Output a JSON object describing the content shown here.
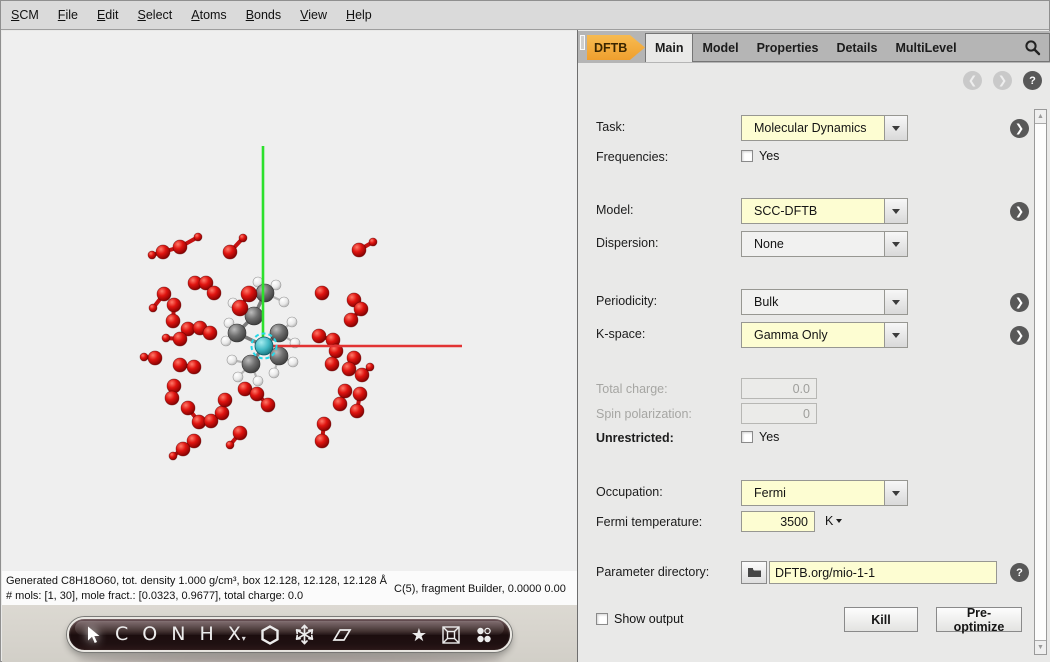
{
  "menubar": {
    "items": [
      {
        "label": "SCM"
      },
      {
        "label": "File"
      },
      {
        "label": "Edit"
      },
      {
        "label": "Select"
      },
      {
        "label": "Atoms"
      },
      {
        "label": "Bonds"
      },
      {
        "label": "View"
      },
      {
        "label": "Help"
      }
    ]
  },
  "panel": {
    "dftb_tab": "DFTB",
    "tabs": [
      {
        "label": "Main",
        "active": true
      },
      {
        "label": "Model"
      },
      {
        "label": "Properties"
      },
      {
        "label": "Details"
      },
      {
        "label": "MultiLevel"
      }
    ],
    "fields": {
      "task": {
        "label": "Task:",
        "value": "Molecular Dynamics"
      },
      "frequencies": {
        "label": "Frequencies:",
        "option": "Yes",
        "checked": false
      },
      "model": {
        "label": "Model:",
        "value": "SCC-DFTB"
      },
      "dispersion": {
        "label": "Dispersion:",
        "value": "None"
      },
      "periodicity": {
        "label": "Periodicity:",
        "value": "Bulk"
      },
      "kspace": {
        "label": "K-space:",
        "value": "Gamma Only"
      },
      "total_charge": {
        "label": "Total charge:",
        "value": "0.0",
        "disabled": true
      },
      "spin_polarization": {
        "label": "Spin polarization:",
        "value": "0",
        "disabled": true
      },
      "unrestricted": {
        "label": "Unrestricted:",
        "option": "Yes",
        "checked": false
      },
      "occupation": {
        "label": "Occupation:",
        "value": "Fermi"
      },
      "fermi_temperature": {
        "label": "Fermi temperature:",
        "value": "3500",
        "unit": "K"
      },
      "parameter_directory": {
        "label": "Parameter directory:",
        "value": "DFTB.org/mio-1-1"
      }
    },
    "show_output": {
      "label": "Show output",
      "checked": false
    },
    "buttons": {
      "kill": "Kill",
      "preoptimize": "Pre-optimize"
    }
  },
  "statusbar": {
    "line1": "Generated C8H18O60, tot. density 1.000 g/cm³, box 12.128, 12.128, 12.128 Å",
    "line2": "# mols: [1, 30], mole fract.: [0.0323, 0.9677], total charge: 0.0",
    "right": "C(5), fragment Builder, 0.0000 0.00"
  },
  "toolbar": {
    "tools": [
      {
        "name": "pointer-tool",
        "active": true
      },
      {
        "name": "carbon-tool",
        "label": "C"
      },
      {
        "name": "oxygen-tool",
        "label": "O"
      },
      {
        "name": "nitrogen-tool",
        "label": "N"
      },
      {
        "name": "hydrogen-tool",
        "label": "H"
      },
      {
        "name": "element-picker-tool",
        "label": "X",
        "dropdown": "▾"
      },
      {
        "name": "ring-tool"
      },
      {
        "name": "crystal-tool"
      },
      {
        "name": "plane-tool"
      },
      {
        "name": "spacer"
      },
      {
        "name": "favorites-tool",
        "label": "★"
      },
      {
        "name": "unit-cell-tool"
      },
      {
        "name": "fragments-tool"
      }
    ]
  },
  "colors": {
    "accent_orange": "#f2a73d",
    "field_yellow": "#fdfdd2",
    "panel_bg": "#e9e9e8",
    "tabbar_bg": "#b5b5b5",
    "axis_green": "#2ce02c",
    "axis_red": "#e23333",
    "atom_red": "#d81414",
    "atom_gray": "#6f6f6f",
    "selection_cyan": "#28d8e8"
  },
  "viewer": {
    "scene": {
      "axes": {
        "green": [
          261,
          115,
          261,
          315
        ],
        "red": [
          262,
          315,
          460,
          315
        ]
      },
      "red_molecules": [
        [
          [
            150,
            224,
            4
          ],
          [
            161,
            221,
            7
          ],
          [
            178,
            216,
            7
          ],
          [
            196,
            206,
            4
          ]
        ],
        [
          [
            228,
            221,
            7
          ],
          [
            241,
            207,
            4
          ]
        ],
        [
          [
            357,
            219,
            7
          ],
          [
            371,
            211,
            4
          ]
        ],
        [
          [
            193,
            252,
            7
          ],
          [
            204,
            252,
            7
          ],
          [
            212,
            262,
            7
          ]
        ],
        [
          [
            162,
            263,
            7
          ],
          [
            151,
            277,
            4
          ]
        ],
        [
          [
            172,
            274,
            7
          ],
          [
            171,
            290,
            7
          ]
        ],
        [
          [
            320,
            262,
            7
          ]
        ],
        [
          [
            352,
            269,
            7
          ],
          [
            359,
            278,
            7
          ],
          [
            349,
            289,
            7
          ]
        ],
        [
          [
            186,
            298,
            7
          ],
          [
            198,
            297,
            7
          ],
          [
            208,
            302,
            7
          ]
        ],
        [
          [
            164,
            307,
            4
          ],
          [
            178,
            308,
            7
          ]
        ],
        [
          [
            317,
            305,
            7
          ],
          [
            331,
            309,
            7
          ],
          [
            334,
            320,
            7
          ],
          [
            330,
            333,
            7
          ]
        ],
        [
          [
            352,
            327,
            7
          ],
          [
            347,
            338,
            7
          ]
        ],
        [
          [
            360,
            344,
            7
          ],
          [
            368,
            336,
            4
          ]
        ],
        [
          [
            153,
            327,
            7
          ],
          [
            142,
            326,
            4
          ]
        ],
        [
          [
            178,
            334,
            7
          ],
          [
            192,
            336,
            7
          ]
        ],
        [
          [
            172,
            355,
            7
          ],
          [
            170,
            367,
            7
          ]
        ],
        [
          [
            186,
            377,
            7
          ],
          [
            197,
            391,
            7
          ],
          [
            209,
            390,
            7
          ],
          [
            220,
            382,
            7
          ],
          [
            223,
            369,
            7
          ]
        ],
        [
          [
            243,
            358,
            7
          ],
          [
            255,
            363,
            7
          ],
          [
            266,
            374,
            7
          ]
        ],
        [
          [
            238,
            402,
            7
          ],
          [
            228,
            414,
            4
          ]
        ],
        [
          [
            192,
            410,
            7
          ],
          [
            181,
            418,
            7
          ],
          [
            171,
            425,
            4
          ]
        ],
        [
          [
            343,
            360,
            7
          ],
          [
            338,
            373,
            7
          ]
        ],
        [
          [
            358,
            363,
            7
          ],
          [
            355,
            380,
            7
          ]
        ],
        [
          [
            322,
            393,
            7
          ],
          [
            320,
            410,
            7
          ]
        ]
      ],
      "central": {
        "carbons": [
          [
            263,
            262
          ],
          [
            252,
            285
          ],
          [
            235,
            302
          ],
          [
            277,
            302
          ],
          [
            277,
            325
          ],
          [
            249,
            333
          ]
        ],
        "cbonds": [
          [
            263,
            262,
            252,
            285
          ],
          [
            252,
            285,
            235,
            302
          ],
          [
            235,
            302,
            262,
            315
          ],
          [
            277,
            302,
            262,
            315
          ],
          [
            249,
            333,
            262,
            315
          ],
          [
            277,
            325,
            262,
            315
          ]
        ],
        "oxygens": [
          [
            247,
            263
          ],
          [
            238,
            277
          ]
        ],
        "obonds": [
          [
            247,
            263,
            238,
            277
          ],
          [
            238,
            277,
            252,
            285
          ]
        ],
        "hydrogens": [
          [
            256,
            251,
            263,
            262
          ],
          [
            274,
            254,
            263,
            262
          ],
          [
            282,
            271,
            263,
            262
          ],
          [
            231,
            272,
            238,
            277
          ],
          [
            227,
            292,
            235,
            302
          ],
          [
            224,
            310,
            235,
            302
          ],
          [
            290,
            291,
            277,
            302
          ],
          [
            293,
            312,
            277,
            302
          ],
          [
            291,
            331,
            277,
            325
          ],
          [
            272,
            342,
            277,
            325
          ],
          [
            236,
            346,
            249,
            333
          ],
          [
            256,
            350,
            249,
            333
          ],
          [
            230,
            329,
            249,
            333
          ]
        ],
        "selected": [
          262,
          315
        ]
      }
    }
  }
}
